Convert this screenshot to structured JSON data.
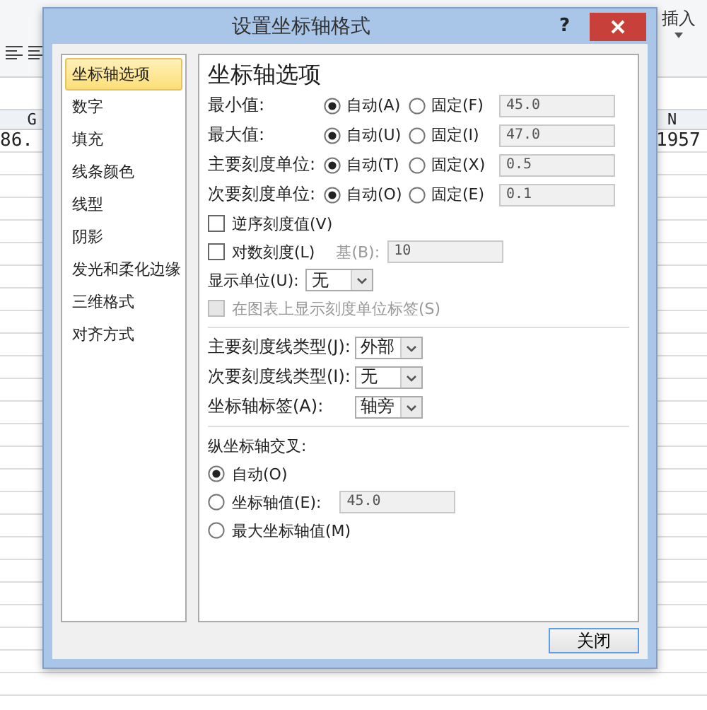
{
  "sheet": {
    "ribbon_button": "插入",
    "column_headers": [
      "G",
      "N"
    ],
    "cells": [
      "86.",
      "1957"
    ]
  },
  "dialog": {
    "title": "设置坐标轴格式",
    "help": "?",
    "categories": [
      {
        "label": "坐标轴选项",
        "selected": true
      },
      {
        "label": "数字",
        "selected": false
      },
      {
        "label": "填充",
        "selected": false
      },
      {
        "label": "线条颜色",
        "selected": false
      },
      {
        "label": "线型",
        "selected": false
      },
      {
        "label": "阴影",
        "selected": false
      },
      {
        "label": "发光和柔化边缘",
        "selected": false
      },
      {
        "label": "三维格式",
        "selected": false
      },
      {
        "label": "对齐方式",
        "selected": false
      }
    ],
    "panel_title": "坐标轴选项",
    "value_rows": [
      {
        "label": "最小值:",
        "options": [
          {
            "label": "自动(A)",
            "selected": true
          },
          {
            "label": "固定(F)",
            "selected": false
          }
        ],
        "value": "45.0",
        "disabled": true
      },
      {
        "label": "最大值:",
        "options": [
          {
            "label": "自动(U)",
            "selected": true
          },
          {
            "label": "固定(I)",
            "selected": false
          }
        ],
        "value": "47.0",
        "disabled": true
      },
      {
        "label": "主要刻度单位:",
        "options": [
          {
            "label": "自动(T)",
            "selected": true
          },
          {
            "label": "固定(X)",
            "selected": false
          }
        ],
        "value": "0.5",
        "disabled": true
      },
      {
        "label": "次要刻度单位:",
        "options": [
          {
            "label": "自动(O)",
            "selected": true
          },
          {
            "label": "固定(E)",
            "selected": false
          }
        ],
        "value": "0.1",
        "disabled": true
      }
    ],
    "reverse": {
      "label": "逆序刻度值(V)",
      "checked": false
    },
    "log": {
      "label": "对数刻度(L)",
      "checked": false,
      "base_label": "基(B):",
      "base_value": "10",
      "disabled": true
    },
    "display_unit": {
      "label": "显示单位(U):",
      "value": "无"
    },
    "show_unit_label": {
      "label": "在图表上显示刻度单位标签(S)",
      "checked": false,
      "disabled": true
    },
    "dropdowns": [
      {
        "label": "主要刻度线类型(J):",
        "value": "外部"
      },
      {
        "label": "次要刻度线类型(I):",
        "value": "无"
      },
      {
        "label": "坐标轴标签(A):",
        "value": "轴旁"
      }
    ],
    "cross": {
      "title": "纵坐标轴交叉:",
      "options": [
        {
          "label": "自动(O)",
          "selected": true
        },
        {
          "label": "坐标轴值(E):",
          "selected": false,
          "value": "45.0",
          "disabled": true
        },
        {
          "label": "最大坐标轴值(M)",
          "selected": false
        }
      ]
    },
    "close_button": "关闭"
  }
}
